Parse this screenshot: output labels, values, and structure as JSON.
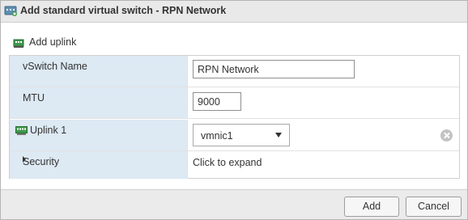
{
  "dialog": {
    "title": "Add standard virtual switch - RPN Network",
    "title_icon": "virtual-switch-icon"
  },
  "toolbar": {
    "add_uplink_label": "Add uplink",
    "add_uplink_icon": "add-uplink-icon"
  },
  "form": {
    "vswitch_name": {
      "label": "vSwitch Name",
      "value": "RPN Network"
    },
    "mtu": {
      "label": "MTU",
      "value": "9000"
    },
    "uplink1": {
      "label": "Uplink 1",
      "icon": "network-adapter-icon",
      "value": "vmnic1"
    },
    "security": {
      "label": "Security",
      "value": "Click to expand"
    }
  },
  "footer": {
    "add_label": "Add",
    "cancel_label": "Cancel"
  },
  "colors": {
    "label_column_bg": "#dde9f3",
    "titlebar_bg": "#e9e9e9",
    "footer_bg": "#ebebeb",
    "nic_icon": "#3f9a4c"
  }
}
